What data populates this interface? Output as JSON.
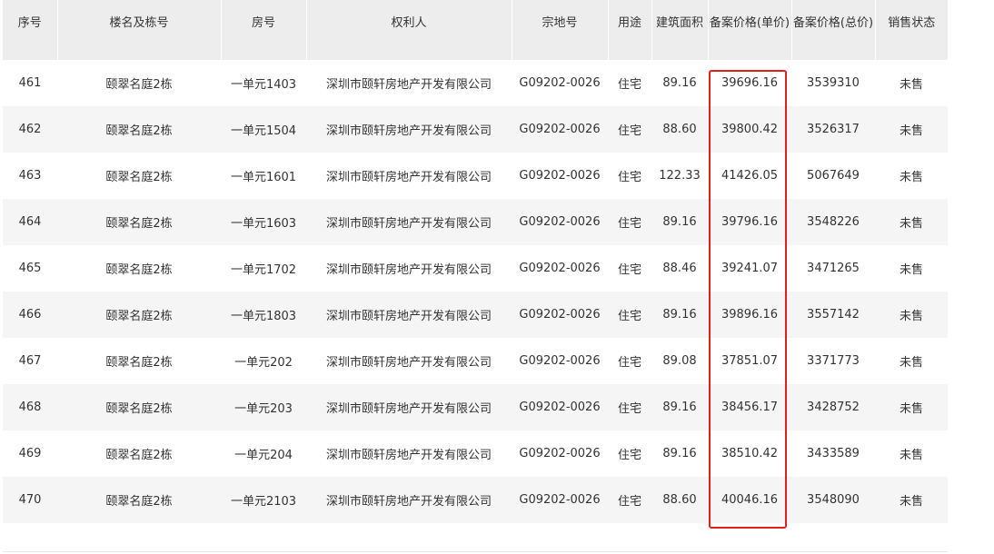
{
  "table": {
    "headers": {
      "index": "序号",
      "building": "楼名及栋号",
      "room": "房号",
      "owner": "权利人",
      "parcel": "宗地号",
      "usage": "用途",
      "area": "建筑面积",
      "unit_price": "备案价格(单价)",
      "total_price": "备案价格(总价)",
      "status": "销售状态"
    },
    "rows": [
      {
        "index": "461",
        "building": "颐翠名庭2栋",
        "room": "一单元1403",
        "owner": "深圳市颐轩房地产开发有限公司",
        "parcel": "G09202-0026",
        "usage": "住宅",
        "area": "89.16",
        "unit_price": "39696.16",
        "total_price": "3539310",
        "status": "未售"
      },
      {
        "index": "462",
        "building": "颐翠名庭2栋",
        "room": "一单元1504",
        "owner": "深圳市颐轩房地产开发有限公司",
        "parcel": "G09202-0026",
        "usage": "住宅",
        "area": "88.60",
        "unit_price": "39800.42",
        "total_price": "3526317",
        "status": "未售"
      },
      {
        "index": "463",
        "building": "颐翠名庭2栋",
        "room": "一单元1601",
        "owner": "深圳市颐轩房地产开发有限公司",
        "parcel": "G09202-0026",
        "usage": "住宅",
        "area": "122.33",
        "unit_price": "41426.05",
        "total_price": "5067649",
        "status": "未售"
      },
      {
        "index": "464",
        "building": "颐翠名庭2栋",
        "room": "一单元1603",
        "owner": "深圳市颐轩房地产开发有限公司",
        "parcel": "G09202-0026",
        "usage": "住宅",
        "area": "89.16",
        "unit_price": "39796.16",
        "total_price": "3548226",
        "status": "未售"
      },
      {
        "index": "465",
        "building": "颐翠名庭2栋",
        "room": "一单元1702",
        "owner": "深圳市颐轩房地产开发有限公司",
        "parcel": "G09202-0026",
        "usage": "住宅",
        "area": "88.46",
        "unit_price": "39241.07",
        "total_price": "3471265",
        "status": "未售"
      },
      {
        "index": "466",
        "building": "颐翠名庭2栋",
        "room": "一单元1803",
        "owner": "深圳市颐轩房地产开发有限公司",
        "parcel": "G09202-0026",
        "usage": "住宅",
        "area": "89.16",
        "unit_price": "39896.16",
        "total_price": "3557142",
        "status": "未售"
      },
      {
        "index": "467",
        "building": "颐翠名庭2栋",
        "room": "一单元202",
        "owner": "深圳市颐轩房地产开发有限公司",
        "parcel": "G09202-0026",
        "usage": "住宅",
        "area": "89.08",
        "unit_price": "37851.07",
        "total_price": "3371773",
        "status": "未售"
      },
      {
        "index": "468",
        "building": "颐翠名庭2栋",
        "room": "一单元203",
        "owner": "深圳市颐轩房地产开发有限公司",
        "parcel": "G09202-0026",
        "usage": "住宅",
        "area": "89.16",
        "unit_price": "38456.17",
        "total_price": "3428752",
        "status": "未售"
      },
      {
        "index": "469",
        "building": "颐翠名庭2栋",
        "room": "一单元204",
        "owner": "深圳市颐轩房地产开发有限公司",
        "parcel": "G09202-0026",
        "usage": "住宅",
        "area": "89.16",
        "unit_price": "38510.42",
        "total_price": "3433589",
        "status": "未售"
      },
      {
        "index": "470",
        "building": "颐翠名庭2栋",
        "room": "一单元2103",
        "owner": "深圳市颐轩房地产开发有限公司",
        "parcel": "G09202-0026",
        "usage": "住宅",
        "area": "88.60",
        "unit_price": "40046.16",
        "total_price": "3548090",
        "status": "未售"
      }
    ]
  },
  "colors": {
    "header_bg": "#ededed",
    "row_alt_bg": "#f5f5f5",
    "highlight_border": "#e0201b",
    "text": "#333333"
  }
}
